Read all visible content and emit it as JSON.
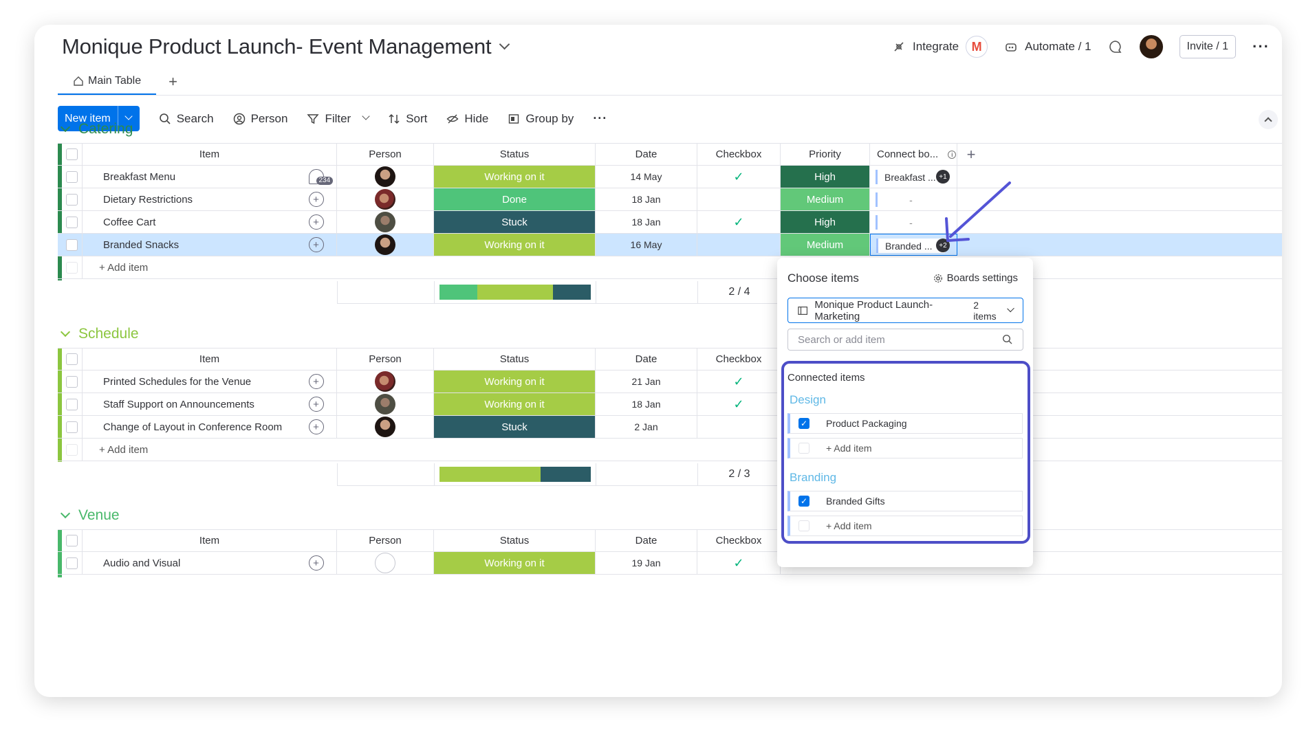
{
  "header": {
    "board_title": "Monique Product Launch- Event Management",
    "integrate": "Integrate",
    "integrate_icon": "gmail-icon",
    "automate": "Automate / 1",
    "invite": "Invite / 1"
  },
  "tabs": {
    "main": "Main Table",
    "add": "+"
  },
  "toolbar": {
    "new_item": "New item",
    "search": "Search",
    "person": "Person",
    "filter": "Filter",
    "sort": "Sort",
    "hide": "Hide",
    "group_by": "Group by"
  },
  "columns": {
    "item": "Item",
    "person": "Person",
    "status": "Status",
    "date": "Date",
    "checkbox": "Checkbox",
    "priority": "Priority",
    "connect": "Connect bo..."
  },
  "colors": {
    "working": "#a5cc46",
    "done": "#4fc47a",
    "stuck": "#2b5c66",
    "high": "#25704d",
    "medium": "#62c879",
    "catering": "#2c8a4f",
    "schedule": "#8cc63f",
    "venue": "#48b86a"
  },
  "groups": [
    {
      "name": "Catering",
      "add_item": "+ Add item",
      "summary_count": "2 / 4",
      "rows": [
        {
          "item": "Breakfast Menu",
          "person": "av1",
          "status": "Working on it",
          "date": "14 May",
          "check": "✓",
          "priority": "High",
          "connect": "Breakfast ...",
          "badge": "+1",
          "conv_badge": "234"
        },
        {
          "item": "Dietary Restrictions",
          "person": "av2",
          "status": "Done",
          "date": "18 Jan",
          "check": "",
          "priority": "Medium",
          "connect": "-",
          "badge": ""
        },
        {
          "item": "Coffee Cart",
          "person": "av3",
          "status": "Stuck",
          "date": "18 Jan",
          "check": "✓",
          "priority": "High",
          "connect": "-",
          "badge": ""
        },
        {
          "item": "Branded Snacks",
          "person": "av1",
          "status": "Working on it",
          "date": "16 May",
          "check": "",
          "priority": "Medium",
          "connect": "Branded ...",
          "badge": "+2"
        }
      ]
    },
    {
      "name": "Schedule",
      "add_item": "+ Add item",
      "summary_count": "2 / 3",
      "rows": [
        {
          "item": "Printed Schedules for the Venue",
          "person": "av2",
          "status": "Working on it",
          "date": "21 Jan",
          "check": "✓"
        },
        {
          "item": "Staff Support on Announcements",
          "person": "av3",
          "status": "Working on it",
          "date": "18 Jan",
          "check": "✓"
        },
        {
          "item": "Change of Layout in Conference Room",
          "person": "av1",
          "status": "Stuck",
          "date": "2 Jan",
          "check": ""
        }
      ]
    },
    {
      "name": "Venue",
      "rows": [
        {
          "item": "Audio and Visual",
          "person": "empty",
          "status": "Working on it",
          "date": "19 Jan",
          "check": "✓"
        }
      ]
    }
  ],
  "popover": {
    "title": "Choose items",
    "settings": "Boards settings",
    "board_name": "Monique Product Launch- Marketing",
    "board_count": "2 items",
    "search_placeholder": "Search or add item",
    "connected_label": "Connected items",
    "groups": [
      {
        "name": "Design",
        "item": "Product Packaging",
        "add": "+ Add item"
      },
      {
        "name": "Branding",
        "item": "Branded Gifts",
        "add": "+ Add item"
      }
    ]
  }
}
